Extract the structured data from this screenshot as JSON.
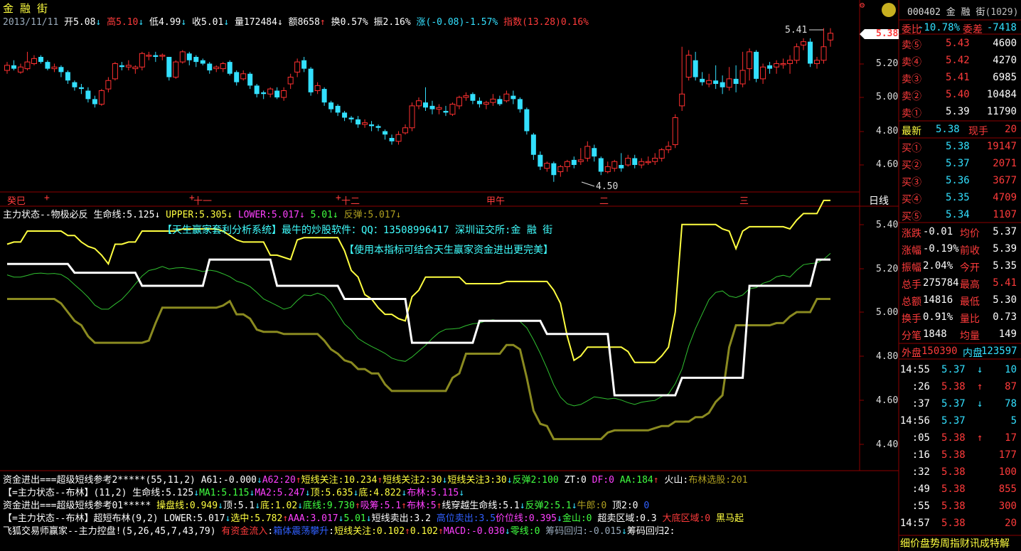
{
  "header": {
    "stock_name": "金 融 街",
    "date": "2013/11/11",
    "open": "开5.08",
    "high": "高5.10",
    "low": "低4.99",
    "close": "收5.01",
    "volume": "量172484",
    "amount": "额8658",
    "turnover": "换0.57%",
    "amplitude": "振2.16%",
    "change": "涨(-0.08)-1.57%",
    "index": "指数(13.28)0.16%"
  },
  "price_axis": [
    "5.20",
    "5.00",
    "4.80",
    "4.60"
  ],
  "current_price_tag": "5.38",
  "candle_annotations": {
    "high_label": "5.41",
    "low_label": "4.50"
  },
  "time_axis": [
    "癸巳",
    "十",
    "十一",
    "十二",
    "甲午",
    "二",
    "三"
  ],
  "period_label": "日线",
  "indicator_title": {
    "name": "主力状态--物极必反",
    "life_line": "生命线:5.125",
    "upper": "UPPER:5.305",
    "lower": "LOWER:5.017",
    "val": "5.01",
    "rebound": "反弹:5.017"
  },
  "ad_lines": [
    "【天生赢家套利分析系统】最牛的炒股软件：QQ：13508996417  深圳证交所:金 融 街",
    "【使用本指标可结合天生赢家资金进出更完美】"
  ],
  "indicator_axis": [
    "5.40",
    "5.20",
    "5.00",
    "4.80",
    "4.60",
    "4.40"
  ],
  "bottom_rows": [
    [
      [
        "资金进出===超级短线参考2*****(55,11,2) A61:-0.000",
        "wht"
      ],
      [
        "↓",
        "cyn"
      ],
      [
        "A62:20",
        "mag"
      ],
      [
        "↑",
        "red"
      ],
      [
        "短线关注:10.234",
        "yel"
      ],
      [
        "↑",
        "red"
      ],
      [
        "短线关注2:30",
        "yel"
      ],
      [
        "↓",
        "cyn"
      ],
      [
        "短线关注3:30",
        "yel"
      ],
      [
        "↓",
        "cyn"
      ],
      [
        "反弹2:100",
        "grnl"
      ],
      [
        " ZT:0 ",
        "wht"
      ],
      [
        "DF:0",
        "mag"
      ],
      [
        " AA:184",
        "grnl"
      ],
      [
        "↑",
        "red"
      ],
      [
        " 火山:",
        "wht"
      ],
      [
        "布林选股:201",
        "olv"
      ]
    ],
    [
      [
        "【=主力状态--布林】(11,2) 生命线:5.125",
        "wht"
      ],
      [
        "↓",
        "cyn"
      ],
      [
        "MA1:5.115",
        "grnl"
      ],
      [
        "↓",
        "cyn"
      ],
      [
        "MA2:5.247",
        "mag"
      ],
      [
        "↓",
        "cyn"
      ],
      [
        "顶:5.635",
        "yel"
      ],
      [
        "↓",
        "cyn"
      ],
      [
        "底:4.822",
        "yel"
      ],
      [
        "↓",
        "cyn"
      ],
      [
        "布林:5.115",
        "mag"
      ],
      [
        "↓",
        "cyn"
      ]
    ],
    [
      [
        "资金进出===超级短线参考01***** ",
        "wht"
      ],
      [
        "操盘线:0.949",
        "yel"
      ],
      [
        "↓",
        "cyn"
      ],
      [
        "顶:5.1",
        "wht"
      ],
      [
        "↓",
        "cyn"
      ],
      [
        "底:1.02",
        "yel"
      ],
      [
        "↓",
        "cyn"
      ],
      [
        "底线:9.730",
        "grnl"
      ],
      [
        "↑",
        "red"
      ],
      [
        "吸筹:5.1",
        "mag"
      ],
      [
        "↑",
        "red"
      ],
      [
        "布林:5",
        "mag"
      ],
      [
        "↑",
        "red"
      ],
      [
        "线穿越生命线:5.1",
        "wht"
      ],
      [
        "↓",
        "cyn"
      ],
      [
        "反弹2:5.1",
        "grnl"
      ],
      [
        "↓",
        "cyn"
      ],
      [
        "牛郎:0",
        "olv"
      ],
      [
        " 顶2:0 ",
        "wht"
      ],
      [
        "0",
        "blu"
      ]
    ],
    [
      [
        "【=主力状态--布林】超短布林(9,2) LOWER:5.017",
        "wht"
      ],
      [
        "↓",
        "cyn"
      ],
      [
        "选中:5.782",
        "yel"
      ],
      [
        "↑",
        "red"
      ],
      [
        "AAA:3.017",
        "mag"
      ],
      [
        "↓",
        "cyn"
      ],
      [
        "5.01",
        "grnl"
      ],
      [
        "↓",
        "cyn"
      ],
      [
        "短线卖出:3.2 ",
        "wht"
      ],
      [
        "高位卖出:3.5",
        "blu"
      ],
      [
        "价位线:0.395",
        "mag"
      ],
      [
        "↓",
        "cyn"
      ],
      [
        "金山:0",
        "grnl"
      ],
      [
        " 超卖区域:0.3 ",
        "wht"
      ],
      [
        "大底区域:0",
        "red"
      ],
      [
        " 黑马起",
        "yel"
      ]
    ],
    [
      [
        "飞狐交易师赢家--主力控盘!(5,26,45,7,43,79) ",
        "wht"
      ],
      [
        "有资金流入",
        "red"
      ],
      [
        ":",
        "wht"
      ],
      [
        "箱体震荡攀升",
        "blu"
      ],
      [
        ":",
        "wht"
      ],
      [
        "短线关注:0.102",
        "yel"
      ],
      [
        "↑",
        "red"
      ],
      [
        "0.102",
        "yel"
      ],
      [
        "↑",
        "red"
      ],
      [
        "MACD:-0.030",
        "mag"
      ],
      [
        "↓",
        "cyn"
      ],
      [
        "零线:0",
        "grnl"
      ],
      [
        "        筹码回归:-0.015",
        "gry"
      ],
      [
        "↓",
        "cyn"
      ],
      [
        "筹码回归2:",
        "wht"
      ]
    ]
  ],
  "quote": {
    "code_name": "000402 金 融 街",
    "code_suffix": "(1029)",
    "commit_ratio_label": "委比",
    "commit_ratio": "-10.78%",
    "commit_diff_label": "委差",
    "commit_diff": "-7418",
    "sells": [
      {
        "label": "卖⑤",
        "price": "5.43",
        "vol": "4600"
      },
      {
        "label": "卖④",
        "price": "5.42",
        "vol": "4270"
      },
      {
        "label": "卖③",
        "price": "5.41",
        "vol": "6985"
      },
      {
        "label": "卖②",
        "price": "5.40",
        "vol": "10484"
      },
      {
        "label": "卖①",
        "price": "5.39",
        "vol": "11790"
      }
    ],
    "latest_label": "最新",
    "latest": "5.38",
    "hand_label": "现手",
    "hand": "20",
    "buys": [
      {
        "label": "买①",
        "price": "5.38",
        "vol": "19147"
      },
      {
        "label": "买②",
        "price": "5.37",
        "vol": "2071"
      },
      {
        "label": "买③",
        "price": "5.36",
        "vol": "3677"
      },
      {
        "label": "买④",
        "price": "5.35",
        "vol": "4709"
      },
      {
        "label": "买⑤",
        "price": "5.34",
        "vol": "1107"
      }
    ],
    "stats": [
      {
        "l1": "涨跌",
        "v1": "-0.01",
        "l2": "均价",
        "v2": "5.37",
        "c1": "wht",
        "c2": "wht"
      },
      {
        "l1": "涨幅",
        "v1": "-0.19%",
        "l2": "前收",
        "v2": "5.39",
        "c1": "wht",
        "c2": "wht"
      },
      {
        "l1": "振幅",
        "v1": "2.04%",
        "l2": "今开",
        "v2": "5.35",
        "c1": "wht",
        "c2": "wht"
      },
      {
        "l1": "总手",
        "v1": "275784",
        "l2": "最高",
        "v2": "5.41",
        "c1": "wht",
        "c2": "red"
      },
      {
        "l1": "总额",
        "v1": "14816",
        "l2": "最低",
        "v2": "5.30",
        "c1": "wht",
        "c2": "wht"
      },
      {
        "l1": "换手",
        "v1": "0.91%",
        "l2": "量比",
        "v2": "0.73",
        "c1": "wht",
        "c2": "wht"
      },
      {
        "l1": "分笔",
        "v1": "1848",
        "l2": "均量",
        "v2": "149",
        "c1": "wht",
        "c2": "wht"
      }
    ],
    "outer_label": "外盘",
    "outer": "150390",
    "inner_label": "内盘",
    "inner": "123597"
  },
  "ticks": [
    {
      "time": "14:55",
      "price": "5.37",
      "dir": "↓",
      "vol": "10",
      "color": "cyn"
    },
    {
      "time": ":26",
      "price": "5.38",
      "dir": "↑",
      "vol": "87",
      "color": "red"
    },
    {
      "time": ":37",
      "price": "5.37",
      "dir": "↓",
      "vol": "78",
      "color": "cyn"
    },
    {
      "time": "14:56",
      "price": "5.37",
      "dir": "",
      "vol": "5",
      "color": "cyn"
    },
    {
      "time": ":05",
      "price": "5.38",
      "dir": "↑",
      "vol": "17",
      "color": "red"
    },
    {
      "time": ":16",
      "price": "5.38",
      "dir": "",
      "vol": "177",
      "color": "red"
    },
    {
      "time": ":32",
      "price": "5.38",
      "dir": "",
      "vol": "100",
      "color": "red"
    },
    {
      "time": ":49",
      "price": "5.38",
      "dir": "",
      "vol": "855",
      "color": "red"
    },
    {
      "time": ":55",
      "price": "5.38",
      "dir": "",
      "vol": "300",
      "color": "red"
    },
    {
      "time": "14:57",
      "price": "5.38",
      "dir": "",
      "vol": "20",
      "color": "red"
    }
  ],
  "bottom_tabs": "细价盘势周指财讯成特解",
  "candles": [
    [
      5.16,
      5.19,
      5.14,
      5.21
    ],
    [
      5.19,
      5.17,
      5.16,
      5.22
    ],
    [
      5.15,
      5.18,
      5.14,
      5.2
    ],
    [
      5.17,
      5.21,
      5.16,
      5.27
    ],
    [
      5.2,
      5.23,
      5.19,
      5.25
    ],
    [
      5.24,
      5.21,
      5.2,
      5.25
    ],
    [
      5.21,
      5.17,
      5.16,
      5.22
    ],
    [
      5.17,
      5.18,
      5.15,
      5.2
    ],
    [
      5.18,
      5.15,
      5.12,
      5.19
    ],
    [
      5.15,
      5.1,
      5.08,
      5.16
    ],
    [
      5.09,
      5.06,
      5.04,
      5.1
    ],
    [
      5.06,
      5.05,
      5.02,
      5.08
    ],
    [
      5.04,
      4.99,
      4.97,
      5.06
    ],
    [
      4.99,
      4.96,
      4.94,
      5.01
    ],
    [
      4.96,
      5.04,
      4.95,
      5.05
    ],
    [
      5.05,
      5.1,
      5.03,
      5.12
    ],
    [
      5.11,
      5.2,
      5.1,
      5.21
    ],
    [
      5.19,
      5.18,
      5.16,
      5.21
    ],
    [
      5.18,
      5.19,
      5.16,
      5.22
    ],
    [
      5.17,
      5.18,
      5.14,
      5.19
    ],
    [
      5.18,
      5.26,
      5.16,
      5.27
    ],
    [
      5.25,
      5.25,
      5.22,
      5.27
    ],
    [
      5.25,
      5.24,
      5.21,
      5.27
    ],
    [
      5.25,
      5.25,
      5.22,
      5.26
    ],
    [
      5.24,
      5.12,
      5.1,
      5.24
    ],
    [
      5.12,
      5.21,
      5.11,
      5.22
    ],
    [
      5.21,
      5.27,
      5.2,
      5.28
    ],
    [
      5.26,
      5.22,
      5.19,
      5.27
    ],
    [
      5.24,
      5.21,
      5.18,
      5.25
    ],
    [
      5.22,
      5.2,
      5.19,
      5.23
    ],
    [
      5.2,
      5.16,
      5.14,
      5.21
    ],
    [
      5.17,
      5.18,
      5.15,
      5.19
    ],
    [
      5.17,
      5.2,
      5.15,
      5.21
    ],
    [
      5.21,
      5.14,
      5.13,
      5.22
    ],
    [
      5.15,
      5.09,
      5.07,
      5.16
    ],
    [
      5.11,
      5.14,
      5.1,
      5.16
    ],
    [
      5.14,
      5.07,
      5.05,
      5.15
    ],
    [
      5.07,
      5.02,
      5.0,
      5.08
    ],
    [
      5.03,
      5.02,
      4.99,
      5.04
    ],
    [
      5.02,
      5.05,
      5.0,
      5.06
    ],
    [
      5.04,
      5.0,
      4.99,
      5.06
    ],
    [
      5.0,
      5.04,
      4.98,
      5.06
    ],
    [
      5.08,
      5.12,
      5.05,
      5.14
    ],
    [
      5.15,
      5.21,
      5.12,
      5.23
    ],
    [
      5.22,
      5.17,
      5.15,
      5.24
    ],
    [
      5.17,
      5.03,
      5.01,
      5.18
    ],
    [
      5.04,
      5.07,
      5.02,
      5.09
    ],
    [
      5.05,
      4.97,
      4.95,
      5.06
    ],
    [
      4.97,
      4.93,
      4.91,
      4.98
    ],
    [
      4.95,
      4.91,
      4.89,
      4.96
    ],
    [
      4.91,
      4.88,
      4.86,
      4.92
    ],
    [
      4.88,
      4.87,
      4.85,
      4.89
    ],
    [
      4.87,
      4.84,
      4.82,
      4.89
    ],
    [
      4.84,
      4.85,
      4.82,
      4.87
    ],
    [
      4.84,
      4.83,
      4.8,
      4.86
    ],
    [
      4.83,
      4.82,
      4.8,
      4.84
    ],
    [
      4.8,
      4.78,
      4.75,
      4.81
    ],
    [
      4.76,
      4.74,
      4.72,
      4.78
    ],
    [
      4.74,
      4.78,
      4.72,
      4.8
    ],
    [
      4.79,
      4.82,
      4.78,
      4.84
    ],
    [
      4.82,
      4.95,
      4.8,
      4.97
    ],
    [
      4.95,
      4.98,
      4.93,
      5.0
    ],
    [
      4.97,
      4.94,
      4.92,
      5.06
    ],
    [
      4.95,
      4.93,
      4.9,
      4.98
    ],
    [
      4.93,
      4.94,
      4.9,
      4.96
    ],
    [
      4.92,
      4.91,
      4.89,
      4.95
    ],
    [
      4.9,
      4.96,
      4.89,
      4.97
    ],
    [
      4.95,
      5.0,
      4.93,
      5.01
    ],
    [
      5.0,
      5.01,
      4.98,
      5.03
    ],
    [
      5.02,
      4.98,
      4.96,
      5.03
    ],
    [
      4.98,
      4.96,
      4.94,
      5.0
    ],
    [
      4.96,
      4.97,
      4.93,
      4.98
    ],
    [
      4.97,
      4.99,
      4.95,
      5.02
    ],
    [
      4.99,
      4.96,
      4.95,
      5.01
    ],
    [
      4.98,
      5.02,
      4.97,
      5.04
    ],
    [
      5.01,
      4.99,
      4.96,
      5.04
    ],
    [
      4.99,
      4.93,
      4.91,
      5.0
    ],
    [
      4.93,
      4.8,
      4.78,
      4.94
    ],
    [
      4.78,
      4.66,
      4.63,
      4.79
    ],
    [
      4.66,
      4.59,
      4.57,
      4.68
    ],
    [
      4.58,
      4.61,
      4.56,
      4.62
    ],
    [
      4.61,
      4.54,
      4.5,
      4.62
    ],
    [
      4.56,
      4.59,
      4.53,
      4.6
    ],
    [
      4.59,
      4.62,
      4.56,
      4.63
    ],
    [
      4.63,
      4.6,
      4.58,
      4.65
    ],
    [
      4.62,
      4.63,
      4.6,
      4.7
    ],
    [
      4.64,
      4.71,
      4.62,
      4.74
    ],
    [
      4.7,
      4.65,
      4.62,
      4.72
    ],
    [
      4.64,
      4.56,
      4.54,
      4.65
    ],
    [
      4.56,
      4.59,
      4.55,
      4.62
    ],
    [
      4.58,
      4.62,
      4.56,
      4.63
    ],
    [
      4.6,
      4.58,
      4.56,
      4.67
    ],
    [
      4.6,
      4.64,
      4.59,
      4.66
    ],
    [
      4.64,
      4.6,
      4.58,
      4.66
    ],
    [
      4.6,
      4.62,
      4.58,
      4.64
    ],
    [
      4.62,
      4.62,
      4.6,
      4.65
    ],
    [
      4.62,
      4.64,
      4.6,
      4.67
    ],
    [
      4.64,
      4.69,
      4.62,
      4.7
    ],
    [
      4.69,
      4.71,
      4.67,
      4.74
    ],
    [
      4.72,
      4.88,
      4.7,
      4.9
    ],
    [
      4.95,
      5.02,
      4.92,
      5.3
    ],
    [
      5.12,
      5.25,
      5.1,
      5.28
    ],
    [
      5.22,
      5.12,
      5.1,
      5.27
    ],
    [
      5.11,
      5.09,
      5.07,
      5.15
    ],
    [
      5.08,
      5.1,
      5.06,
      5.14
    ],
    [
      5.1,
      5.08,
      5.05,
      5.19
    ],
    [
      5.09,
      5.06,
      5.02,
      5.13
    ],
    [
      5.06,
      5.11,
      5.04,
      5.18
    ],
    [
      5.11,
      5.08,
      5.03,
      5.19
    ],
    [
      5.08,
      5.16,
      5.06,
      5.27
    ],
    [
      5.17,
      5.27,
      5.1,
      5.29
    ],
    [
      5.27,
      5.11,
      5.09,
      5.28
    ],
    [
      5.11,
      5.18,
      5.08,
      5.2
    ],
    [
      5.19,
      5.17,
      5.14,
      5.21
    ],
    [
      5.18,
      5.2,
      5.14,
      5.22
    ],
    [
      5.2,
      5.2,
      5.17,
      5.23
    ],
    [
      5.2,
      5.22,
      5.14,
      5.25
    ],
    [
      5.22,
      5.3,
      5.2,
      5.32
    ],
    [
      5.31,
      5.33,
      5.28,
      5.35
    ],
    [
      5.33,
      5.2,
      5.18,
      5.35
    ],
    [
      5.2,
      5.22,
      5.17,
      5.24
    ],
    [
      5.22,
      5.3,
      5.2,
      5.41
    ],
    [
      5.34,
      5.38,
      5.3,
      5.41
    ]
  ]
}
